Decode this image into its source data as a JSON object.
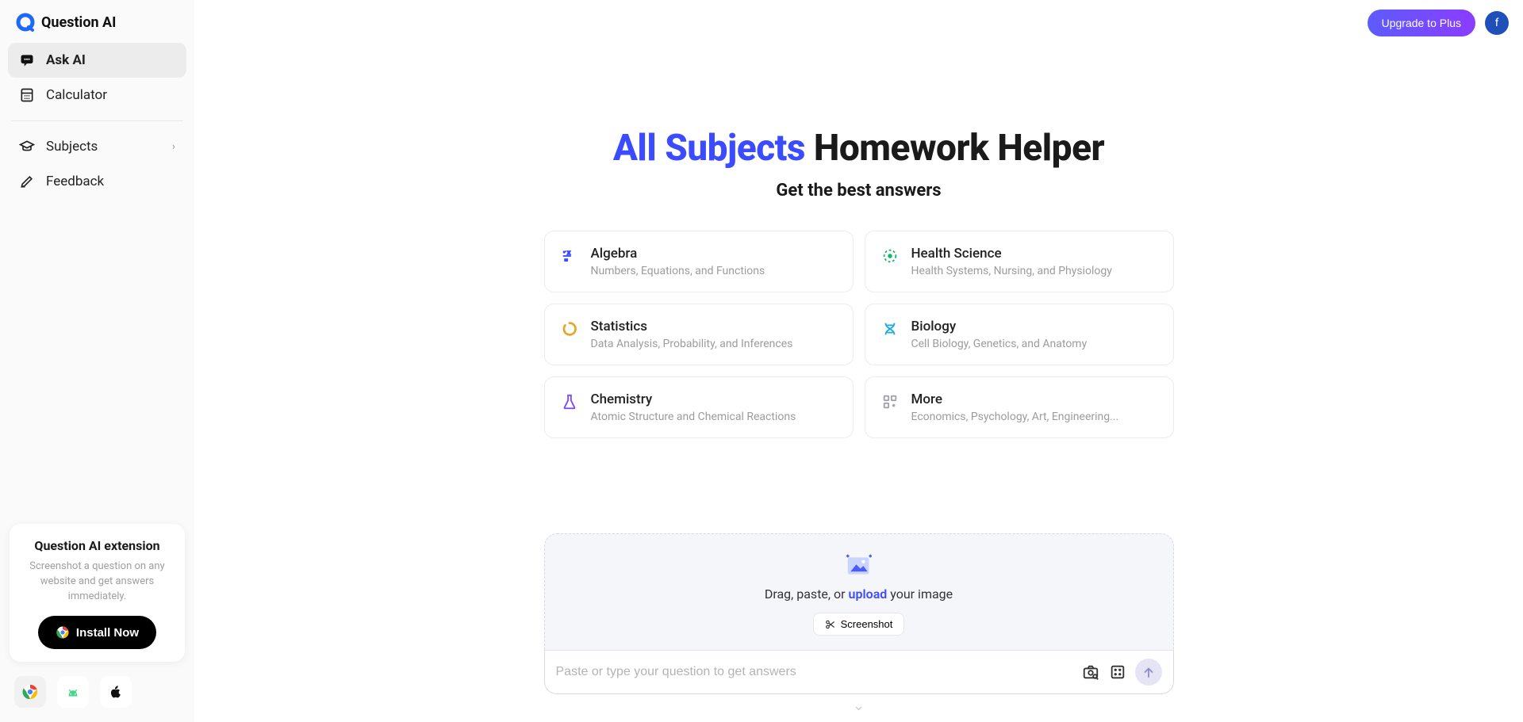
{
  "brand": {
    "name": "Question AI"
  },
  "topbar": {
    "upgrade_label": "Upgrade to Plus",
    "avatar_initial": "f"
  },
  "sidebar": {
    "items": [
      {
        "id": "ask-ai",
        "label": "Ask AI",
        "active": true
      },
      {
        "id": "calculator",
        "label": "Calculator",
        "active": false
      }
    ],
    "items2": [
      {
        "id": "subjects",
        "label": "Subjects",
        "expandable": true
      },
      {
        "id": "feedback",
        "label": "Feedback",
        "expandable": false
      }
    ],
    "promo": {
      "title": "Question AI extension",
      "desc": "Screenshot a question on any website and get answers immediately.",
      "install_label": "Install Now"
    }
  },
  "hero": {
    "title_highlight": "All Subjects",
    "title_rest": " Homework Helper",
    "subtitle": "Get the best answers"
  },
  "subjects": [
    {
      "id": "algebra",
      "name": "Algebra",
      "desc": "Numbers, Equations, and Functions",
      "color": "#3b4bff"
    },
    {
      "id": "health-science",
      "name": "Health Science",
      "desc": "Health Systems, Nursing, and Physiology",
      "color": "#10b66a"
    },
    {
      "id": "statistics",
      "name": "Statistics",
      "desc": "Data Analysis, Probability, and Inferences",
      "color": "#e6a728"
    },
    {
      "id": "biology",
      "name": "Biology",
      "desc": "Cell Biology, Genetics, and Anatomy",
      "color": "#1aa9e0"
    },
    {
      "id": "chemistry",
      "name": "Chemistry",
      "desc": "Atomic Structure and Chemical Reactions",
      "color": "#7b46ff"
    },
    {
      "id": "more",
      "name": "More",
      "desc": "Economics, Psychology, Art, Engineering...",
      "color": "#a1a1a9"
    }
  ],
  "dropzone": {
    "prefix": "Drag, paste, or ",
    "upload": "upload",
    "suffix": " your image",
    "screenshot_label": "Screenshot"
  },
  "question_input": {
    "placeholder": "Paste or type your question to get answers"
  }
}
